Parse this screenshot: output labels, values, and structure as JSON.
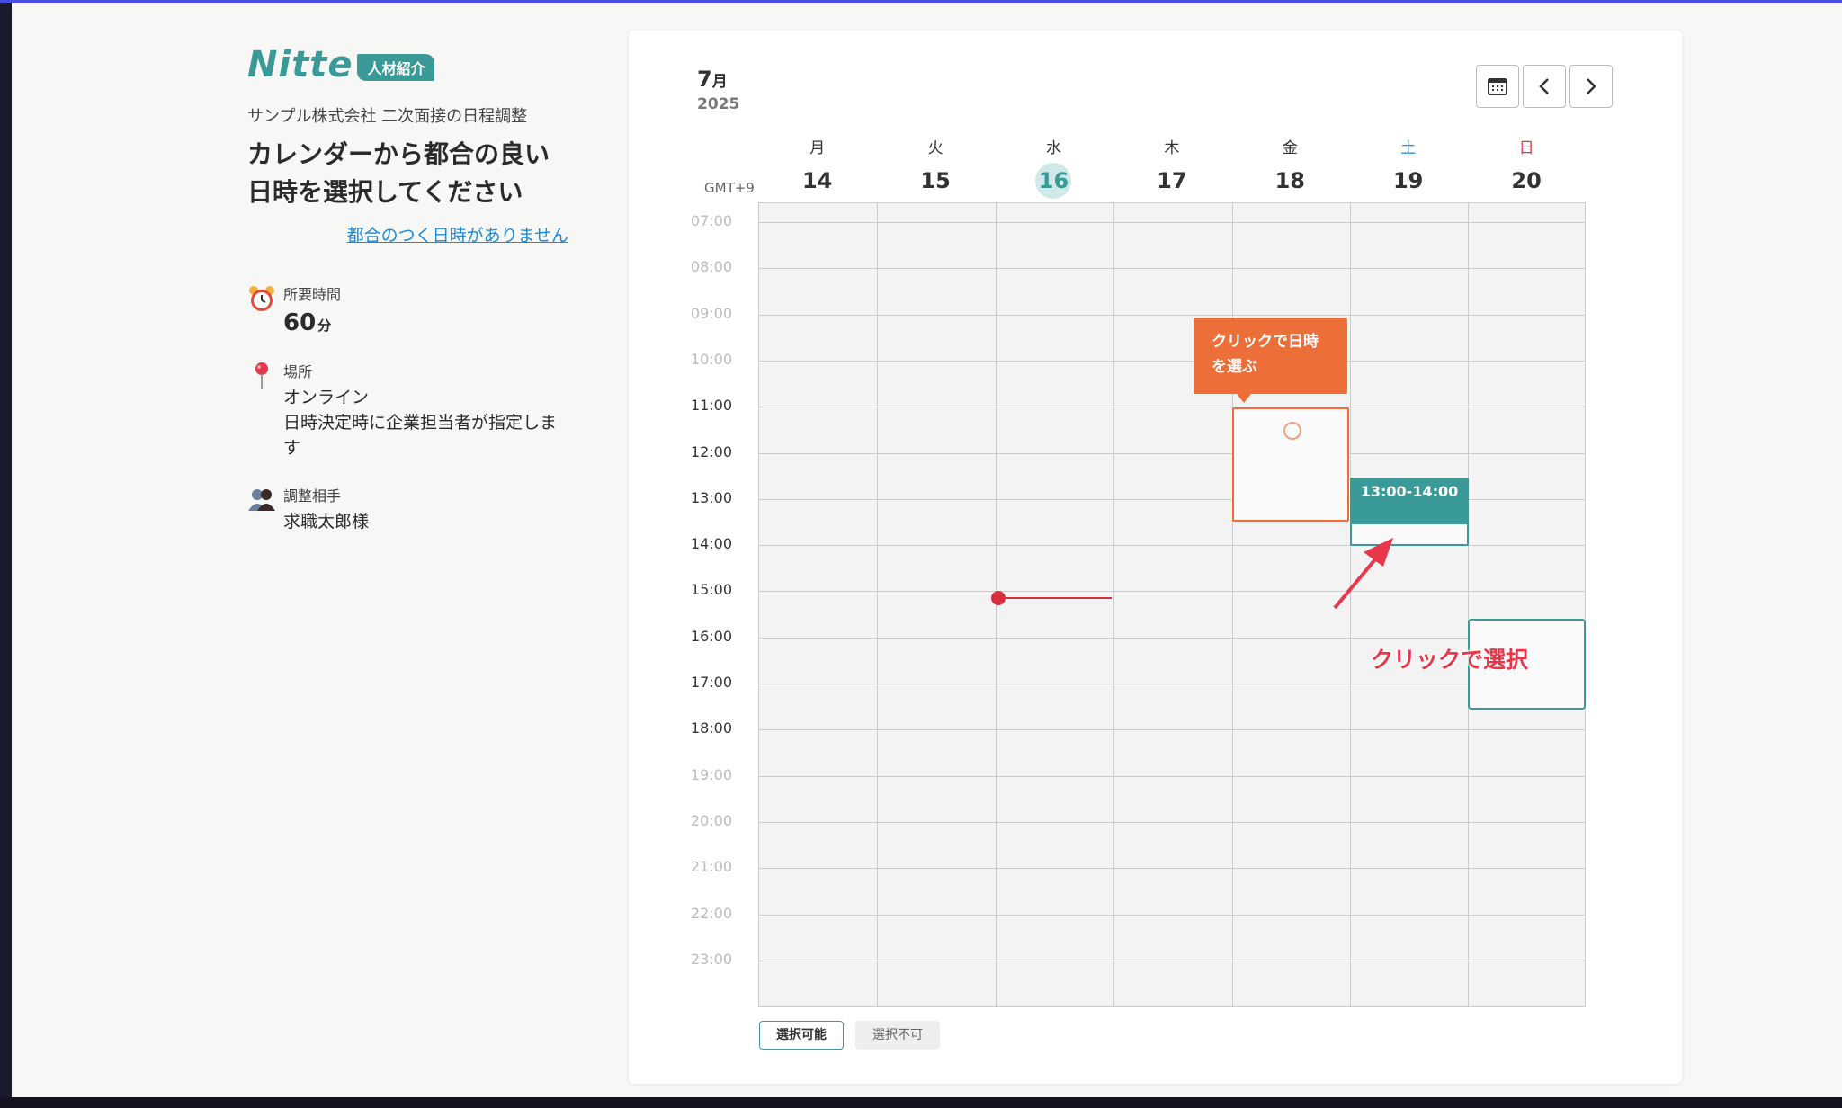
{
  "brand": {
    "logo": "Nitte",
    "badge": "人材紹介"
  },
  "sidebar": {
    "company_line": "サンプル株式会社 二次面接の日程調整",
    "heading_line1": "カレンダーから都合の良い",
    "heading_line2": "日時を選択してください",
    "no_time_link": "都合のつく日時がありません",
    "duration": {
      "label": "所要時間",
      "value": "60",
      "unit": "分",
      "icon": "alarm-clock-icon"
    },
    "location": {
      "label": "場所",
      "line1": "オンライン",
      "line2": "日時決定時に企業担当者が指定しま",
      "line3": "す",
      "icon": "map-pin-icon"
    },
    "partner": {
      "label": "調整相手",
      "value": "求職太郎様",
      "icon": "people-icon"
    }
  },
  "calendar": {
    "month_num": "7",
    "month_kanji": "月",
    "year": "2025",
    "timezone": "GMT+9",
    "days": [
      {
        "dow": "月",
        "num": "14"
      },
      {
        "dow": "火",
        "num": "15"
      },
      {
        "dow": "水",
        "num": "16",
        "today": true
      },
      {
        "dow": "木",
        "num": "17"
      },
      {
        "dow": "金",
        "num": "18"
      },
      {
        "dow": "土",
        "num": "19"
      },
      {
        "dow": "日",
        "num": "20"
      }
    ],
    "hours": [
      "07:00",
      "08:00",
      "09:00",
      "10:00",
      "11:00",
      "12:00",
      "13:00",
      "14:00",
      "15:00",
      "16:00",
      "17:00",
      "18:00",
      "19:00",
      "20:00",
      "21:00",
      "22:00",
      "23:00"
    ],
    "tooltip_line1": "クリックで日時",
    "tooltip_line2": "を選ぶ",
    "selected_slot": "13:00-14:00",
    "annotation": "クリックで選択",
    "legend_available": "選択可能",
    "legend_unavailable": "選択不可",
    "colors": {
      "accent": "#3a9a98",
      "orange": "#ec6f3a",
      "now": "#d7303c",
      "annotation": "#e8364a"
    }
  }
}
